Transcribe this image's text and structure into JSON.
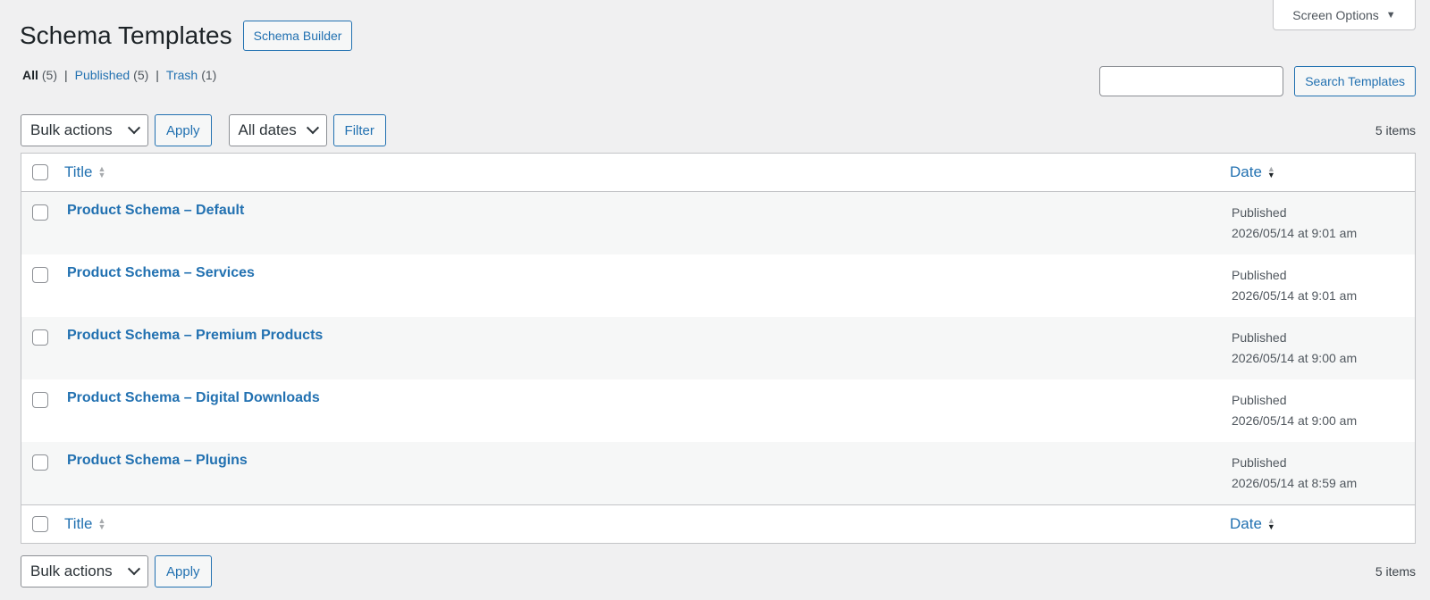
{
  "screen_options": {
    "label": "Screen Options",
    "arrow": "▼"
  },
  "header": {
    "title": "Schema Templates",
    "action_label": "Schema Builder"
  },
  "views": {
    "all": {
      "label": "All",
      "count": "(5)"
    },
    "published": {
      "label": "Published",
      "count": "(5)"
    },
    "trash": {
      "label": "Trash",
      "count": "(1)"
    },
    "separator": "|"
  },
  "search": {
    "value": "",
    "button_label": "Search Templates"
  },
  "tablenav_top": {
    "bulk_actions": "Bulk actions",
    "apply_label": "Apply",
    "dates": "All dates",
    "filter_label": "Filter",
    "count": "5 items"
  },
  "tablenav_bottom": {
    "bulk_actions": "Bulk actions",
    "apply_label": "Apply",
    "count": "5 items"
  },
  "table": {
    "columns": {
      "title": "Title",
      "date": "Date"
    },
    "rows": [
      {
        "title": "Product Schema – Default",
        "status": "Published",
        "date": "2026/05/14 at 9:01 am"
      },
      {
        "title": "Product Schema – Services",
        "status": "Published",
        "date": "2026/05/14 at 9:01 am"
      },
      {
        "title": "Product Schema – Premium Products",
        "status": "Published",
        "date": "2026/05/14 at 9:00 am"
      },
      {
        "title": "Product Schema – Digital Downloads",
        "status": "Published",
        "date": "2026/05/14 at 9:00 am"
      },
      {
        "title": "Product Schema – Plugins",
        "status": "Published",
        "date": "2026/05/14 at 8:59 am"
      }
    ]
  }
}
